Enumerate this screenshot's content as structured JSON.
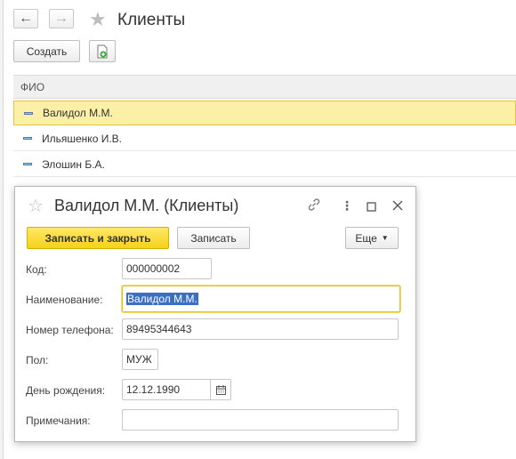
{
  "header": {
    "title": "Клиенты",
    "create_label": "Создать"
  },
  "list": {
    "column": "ФИО",
    "rows": [
      "Валидол М.М.",
      "Ильяшенко И.В.",
      "Элошин Б.А."
    ],
    "selected_index": 0
  },
  "dialog": {
    "title": "Валидол М.М. (Клиенты)",
    "save_close_label": "Записать и закрыть",
    "save_label": "Записать",
    "more_label": "Еще",
    "fields": {
      "code_label": "Код:",
      "code_value": "000000002",
      "name_label": "Наименование:",
      "name_value": "Валидол М.М.",
      "phone_label": "Номер телефона:",
      "phone_value": "89495344643",
      "gender_label": "Пол:",
      "gender_value": "МУЖ",
      "birthday_label": "День рождения:",
      "birthday_value": "12.12.1990",
      "notes_label": "Примечания:",
      "notes_value": ""
    }
  },
  "colors": {
    "accent_yellow": "#f5d21c",
    "selection": "#fcefa6",
    "text_highlight": "#3a6fc4"
  }
}
